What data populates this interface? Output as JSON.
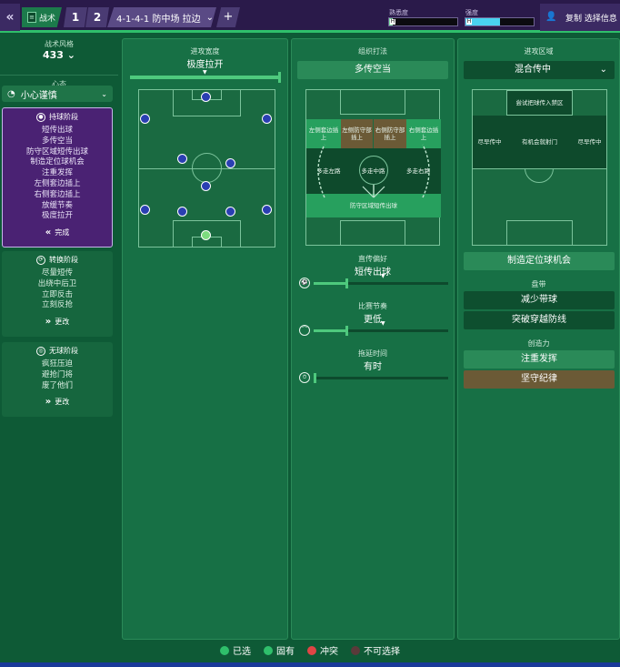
{
  "topbar": {
    "back_label": "«",
    "tactic_label": "战术",
    "slot1": "1",
    "slot2": "2",
    "formation": "4-1-4-1 防中场 拉边",
    "formation_chev": "⌄",
    "plus": "+",
    "familiarity_label": "熟悉度",
    "familiarity_mark": "H",
    "familiarity_value": 0.05,
    "intensity_label": "强度",
    "intensity_mark": "H",
    "intensity_value": 0.5,
    "copy_label": "复制 选择信息",
    "colors": {
      "bar": "#2a1a4a",
      "stripe": "#2fbf6b",
      "familiarity": "#7fe0a2",
      "intensity": "#49d3f0"
    }
  },
  "left": {
    "style_label": "战术风格",
    "style_value": "433 ⌄",
    "mentality_label": "心态",
    "mentality_value": "小心谨慎",
    "mentality_icon": "gauge-icon",
    "phases": [
      {
        "title": "持球阶段",
        "items": [
          "短传出球",
          "多传空当",
          "防守区域短传出球",
          "制造定位球机会",
          "注重发挥",
          "左侧套边插上",
          "右侧套边插上",
          "放缓节奏",
          "极度拉开"
        ],
        "button": "完成",
        "button_icon": "«"
      },
      {
        "title": "转换阶段",
        "items": [
          "尽量短传",
          "出绕中后卫",
          "立即反击",
          "立刻反抢"
        ],
        "button": "更改",
        "button_icon": "»"
      },
      {
        "title": "无球阶段",
        "items": [
          "疯狂压迫",
          "避抢门将",
          "废了他们"
        ],
        "button": "更改",
        "button_icon": "»"
      }
    ]
  },
  "panel1": {
    "title": "进攻宽度",
    "value": "极度拉开",
    "width_value": 1.0
  },
  "panel2": {
    "title": "组织打法",
    "value": "多传空当",
    "zones": {
      "left_overlap": "左侧套边插上",
      "left_fb": "左侧防守部插上",
      "right_fb": "右侧防守部插上",
      "right_overlap": "右侧套边插上",
      "left_channel": "多走左路",
      "center_channel": "多走中路",
      "right_channel": "多走右路",
      "defensive_short": "防守区域短传出球"
    },
    "sliders": [
      {
        "label": "直传偏好",
        "value": "短传出球",
        "icon": "ball-icon",
        "fill": 0.25
      },
      {
        "label": "比赛节奏",
        "value": "更低",
        "icon": "tempo-icon",
        "fill": 0.25
      },
      {
        "label": "拖延时间",
        "value": "有时",
        "icon": "stopwatch-icon",
        "fill": 0.0
      }
    ]
  },
  "panel3": {
    "title": "进攻区域",
    "dropdown": "混合传中",
    "dropdown_chev": "⌄",
    "zones": {
      "top": "尝试把球传入禁区",
      "left": "尽早传中",
      "center": "有机会就射门",
      "right": "尽早传中"
    },
    "set_piece_btn": "制造定位球机会",
    "dribble_label": "盘带",
    "dribble_options": [
      "减少带球",
      "突破穿越防线"
    ],
    "creativity_label": "创造力",
    "creativity_options": [
      "注重发挥",
      "坚守纪律"
    ]
  },
  "legend": [
    {
      "label": "已选",
      "color": "#2fbf6b"
    },
    {
      "label": "固有",
      "color": "#2fbf6b"
    },
    {
      "label": "冲突",
      "color": "#e04545"
    },
    {
      "label": "不可选择",
      "color": "#5a3a3a"
    }
  ]
}
